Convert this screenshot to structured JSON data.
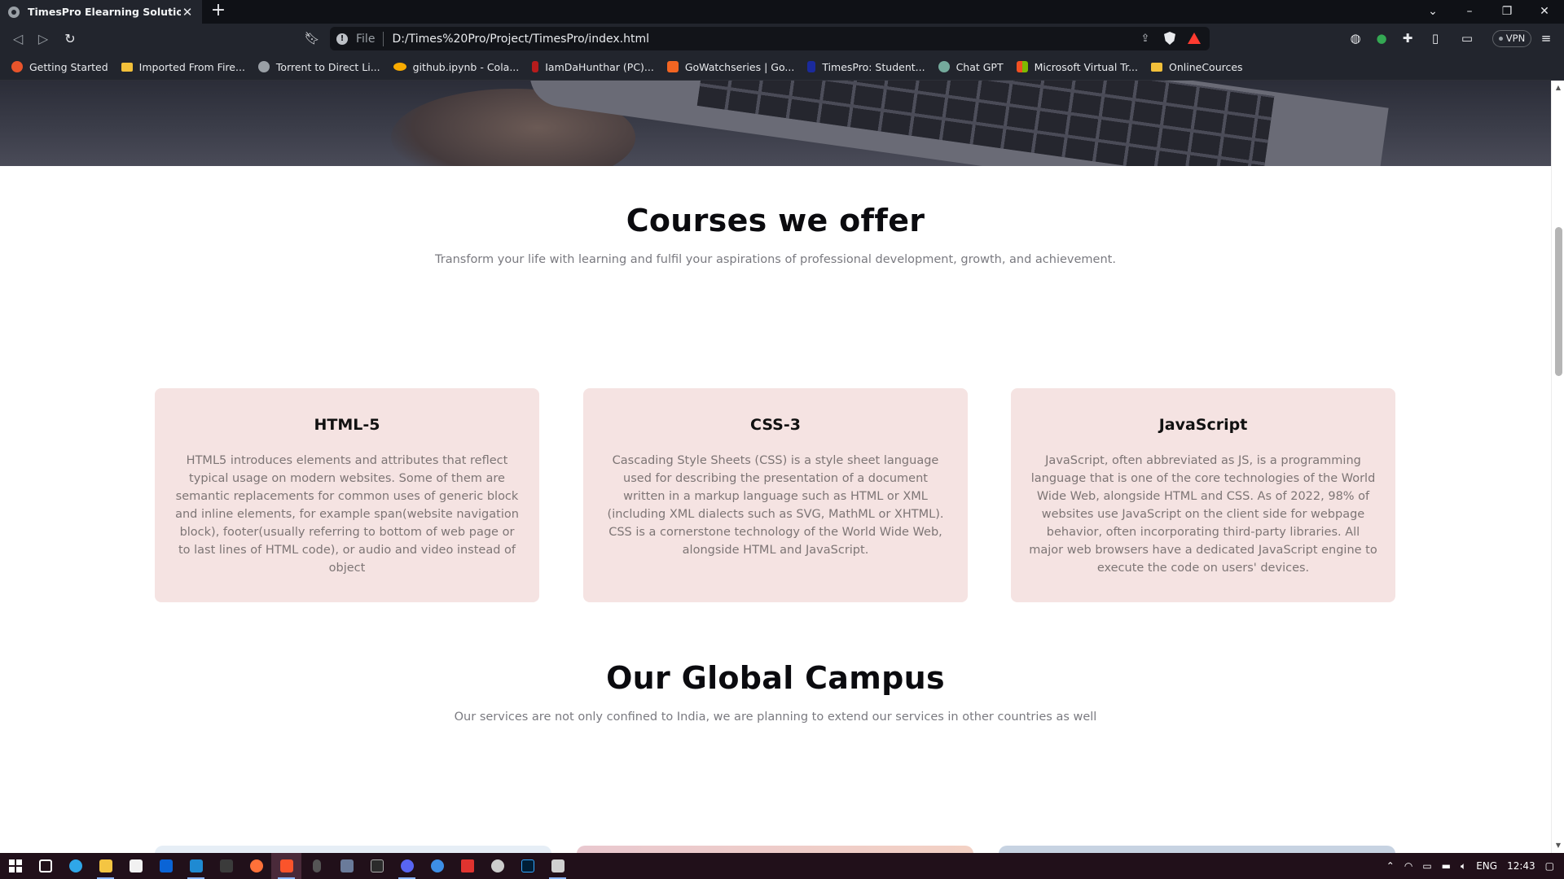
{
  "browser": {
    "tab_title": "TimesPro Elearning Solutions",
    "tab_close": "✕",
    "new_tab": "+",
    "scheme_label": "File",
    "url": "D:/Times%20Pro/Project/TimesPro/index.html",
    "vpn_label": "VPN",
    "bookmarks": [
      {
        "label": "Getting Started",
        "icon": "firefox-icon",
        "color": "#e8542b"
      },
      {
        "label": "Imported From Fire...",
        "icon": "folder-icon",
        "color": "#f2c03a"
      },
      {
        "label": "Torrent to Direct Li...",
        "icon": "globe-icon",
        "color": "#9aa0a6"
      },
      {
        "label": "github.ipynb - Cola...",
        "icon": "colab-icon",
        "color": "#f9ab00"
      },
      {
        "label": "IamDaHunthar (PC)...",
        "icon": "user-icon",
        "color": "#b71c1c"
      },
      {
        "label": "GoWatchseries | Go...",
        "icon": "gowatch-icon",
        "color": "#f26522"
      },
      {
        "label": "TimesPro: Student...",
        "icon": "timespro-icon",
        "color": "#1a2a9c"
      },
      {
        "label": "Chat GPT",
        "icon": "chatgpt-icon",
        "color": "#74aa9c"
      },
      {
        "label": "Microsoft Virtual Tr...",
        "icon": "microsoft-icon",
        "color": "#f25022"
      },
      {
        "label": "OnlineCources",
        "icon": "folder-icon",
        "color": "#f2c03a"
      }
    ]
  },
  "page": {
    "courses": {
      "title": "Courses we offer",
      "subtitle": "Transform your life with learning and fulfil your aspirations of professional development, growth, and achievement.",
      "cards": [
        {
          "title": "HTML-5",
          "text": "HTML5 introduces elements and attributes that reflect typical usage on modern websites. Some of them are semantic replacements for common uses of generic block and inline elements, for example span(website navigation block), footer(usually referring to bottom of web page or to last lines of HTML code), or audio and video instead of object"
        },
        {
          "title": "CSS-3",
          "text": "Cascading Style Sheets (CSS) is a style sheet language used for describing the presentation of a document written in a markup language such as HTML or XML (including XML dialects such as SVG, MathML or XHTML). CSS is a cornerstone technology of the World Wide Web, alongside HTML and JavaScript."
        },
        {
          "title": "JavaScript",
          "text": "JavaScript, often abbreviated as JS, is a programming language that is one of the core technologies of the World Wide Web, alongside HTML and CSS. As of 2022, 98% of websites use JavaScript on the client side for webpage behavior, often incorporating third-party libraries. All major web browsers have a dedicated JavaScript engine to execute the code on users' devices."
        }
      ]
    },
    "campus": {
      "title": "Our Global Campus",
      "subtitle": "Our services are not only confined to India, we are planning to extend our services in other countries as well"
    }
  },
  "taskbar": {
    "language": "ENG",
    "time": "12:43"
  },
  "colors": {
    "card_bg": "#f5e3e2",
    "heading": "#0b0b0f",
    "muted_text": "#7d7575"
  }
}
